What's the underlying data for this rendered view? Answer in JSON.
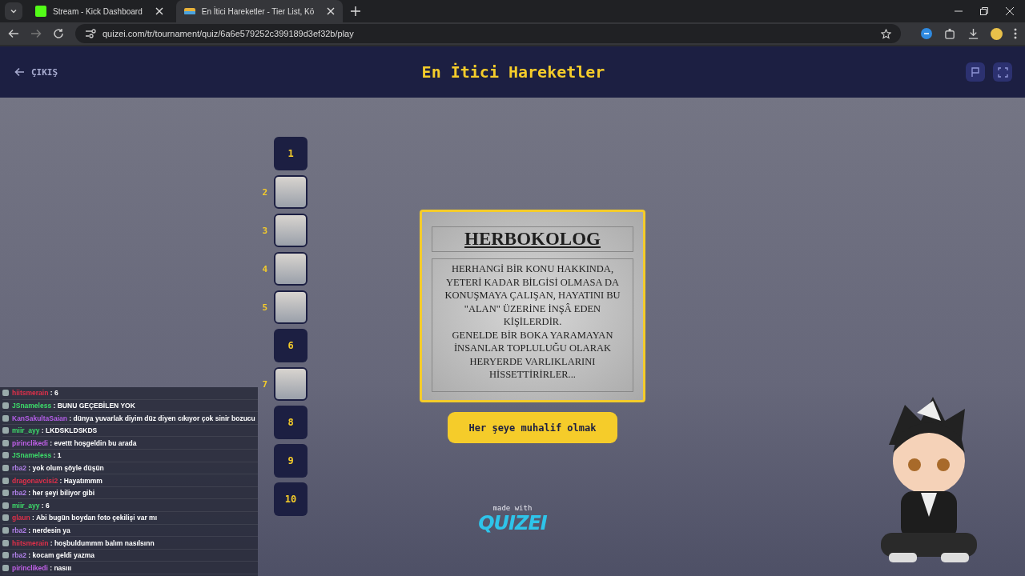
{
  "browser": {
    "tabs": [
      {
        "title": "Stream - Kick Dashboard",
        "selected": false
      },
      {
        "title": "En İtici Hareketler - Tier List, Kö",
        "selected": true
      }
    ],
    "url": "quizei.com/tr/tournament/quiz/6a6e579252c399189d3ef32b/play"
  },
  "header": {
    "back_label": "ÇIKIŞ",
    "title": "En İtici Hareketler"
  },
  "slots": [
    {
      "number": "1",
      "kind": "empty"
    },
    {
      "number": "2",
      "kind": "photo"
    },
    {
      "number": "3",
      "kind": "photo"
    },
    {
      "number": "4",
      "kind": "photo"
    },
    {
      "number": "5",
      "kind": "photo"
    },
    {
      "number": "6",
      "kind": "empty"
    },
    {
      "number": "7",
      "kind": "photo"
    },
    {
      "number": "8",
      "kind": "empty"
    },
    {
      "number": "9",
      "kind": "empty"
    },
    {
      "number": "10",
      "kind": "empty"
    }
  ],
  "card": {
    "heading": "HERBOKOLOG",
    "body": [
      "HERHANGİ BİR KONU HAKKINDA, YETERİ KADAR BİLGİSİ OLMASA DA KONUŞMAYA ÇALIŞAN, HAYATINI BU \"ALAN\" ÜZERİNE İNŞÂ EDEN KİŞİLERDİR.",
      "GENELDE BİR BOKA YARAMAYAN İNSANLAR TOPLULUĞU OLARAK HERYERDE VARLIKLARINI HİSSETTİRİRLER..."
    ]
  },
  "answer": "Her şeye muhalif olmak",
  "credit": {
    "prefix": "made with",
    "brand": "QUIZEI"
  },
  "chat": [
    {
      "user": "hiitsmerain",
      "color": "#e0304a",
      "text": ": 6"
    },
    {
      "user": "JSnameless",
      "color": "#3ddc6a",
      "text": ": BUNU GEÇEBİLEN YOK"
    },
    {
      "user": "KanSakultaSaian",
      "color": "#b45ee8",
      "text": ": dünya yuvarlak diyim düz diyen cıkıyor çok sinir bozucu"
    },
    {
      "user": "miir_ayy",
      "color": "#3ddc6a",
      "text": ": LKDSKLDSKDS"
    },
    {
      "user": "pirinclikedi",
      "color": "#c060e8",
      "text": ": evettt hoşgeldin bu arada"
    },
    {
      "user": "JSnameless",
      "color": "#3ddc6a",
      "text": ": 1"
    },
    {
      "user": "rba2",
      "color": "#b080e8",
      "text": ": yok olum şöyle düşün"
    },
    {
      "user": "dragonavcisi2",
      "color": "#e0304a",
      "text": ": Hayatımmm"
    },
    {
      "user": "rba2",
      "color": "#b080e8",
      "text": ": her şeyi biliyor gibi"
    },
    {
      "user": "miir_ayy",
      "color": "#3ddc6a",
      "text": ": 6"
    },
    {
      "user": "glaun",
      "color": "#e0304a",
      "text": ": Abi bugün boydan foto çekilişi var mı"
    },
    {
      "user": "rba2",
      "color": "#b080e8",
      "text": ": nerdesin ya"
    },
    {
      "user": "hiitsmerain",
      "color": "#e0304a",
      "text": ": hoşbuldummm balım nasılsınn"
    },
    {
      "user": "rba2",
      "color": "#b080e8",
      "text": ": kocam geldi yazma"
    },
    {
      "user": "pirinclikedi",
      "color": "#c060e8",
      "text": ": nasııı"
    }
  ]
}
